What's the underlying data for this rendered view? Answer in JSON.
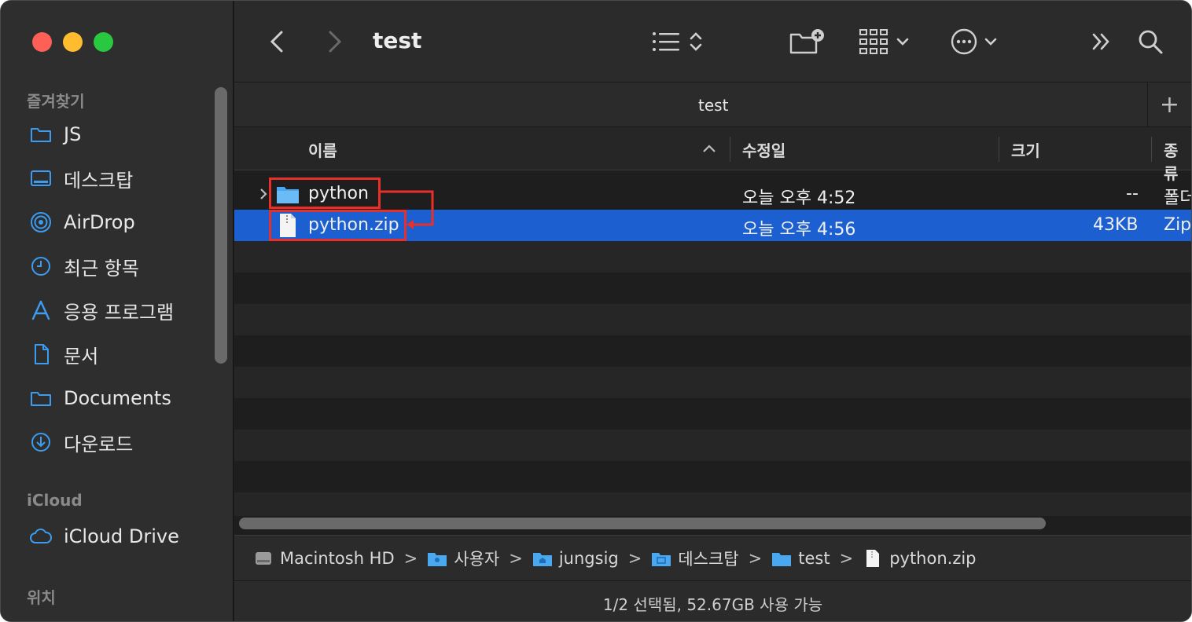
{
  "sidebar": {
    "section_favorites": "즐겨찾기",
    "favorites": [
      {
        "label": "JS",
        "icon": "folder-icon"
      },
      {
        "label": "데스크탑",
        "icon": "desktop-icon"
      },
      {
        "label": "AirDrop",
        "icon": "airdrop-icon"
      },
      {
        "label": "최근 항목",
        "icon": "clock-icon"
      },
      {
        "label": "응용 프로그램",
        "icon": "applications-icon"
      },
      {
        "label": "문서",
        "icon": "document-icon"
      },
      {
        "label": "Documents",
        "icon": "folder-icon"
      },
      {
        "label": "다운로드",
        "icon": "download-icon"
      }
    ],
    "section_icloud": "iCloud",
    "icloud": [
      {
        "label": "iCloud Drive",
        "icon": "cloud-icon"
      }
    ],
    "section_locations": "위치"
  },
  "toolbar": {
    "title": "test"
  },
  "tab": {
    "title": "test",
    "add_label": "+"
  },
  "columns": {
    "name": "이름",
    "modified": "수정일",
    "size": "크기",
    "kind": "종류"
  },
  "files": [
    {
      "name": "python",
      "modified": "오늘 오후 4:52",
      "size": "--",
      "kind": "폴더",
      "type": "folder",
      "selected": false
    },
    {
      "name": "python.zip",
      "modified": "오늘 오후 4:56",
      "size": "43KB",
      "kind": "Zip",
      "type": "zip",
      "selected": true
    }
  ],
  "pathbar": [
    {
      "label": "Macintosh HD",
      "icon": "hard-drive-icon"
    },
    {
      "label": "사용자",
      "icon": "users-folder-icon"
    },
    {
      "label": "jungsig",
      "icon": "home-folder-icon"
    },
    {
      "label": "데스크탑",
      "icon": "desktop-folder-icon"
    },
    {
      "label": "test",
      "icon": "folder-icon"
    },
    {
      "label": "python.zip",
      "icon": "zip-file-icon"
    }
  ],
  "pathbar_separator": ">",
  "status": "1/2 선택됨, 52.67GB 사용 가능",
  "colors": {
    "accent_selection": "#1b5fd1",
    "annotation_red": "#e8302a",
    "sidebar_icon": "#3b9cf0"
  }
}
